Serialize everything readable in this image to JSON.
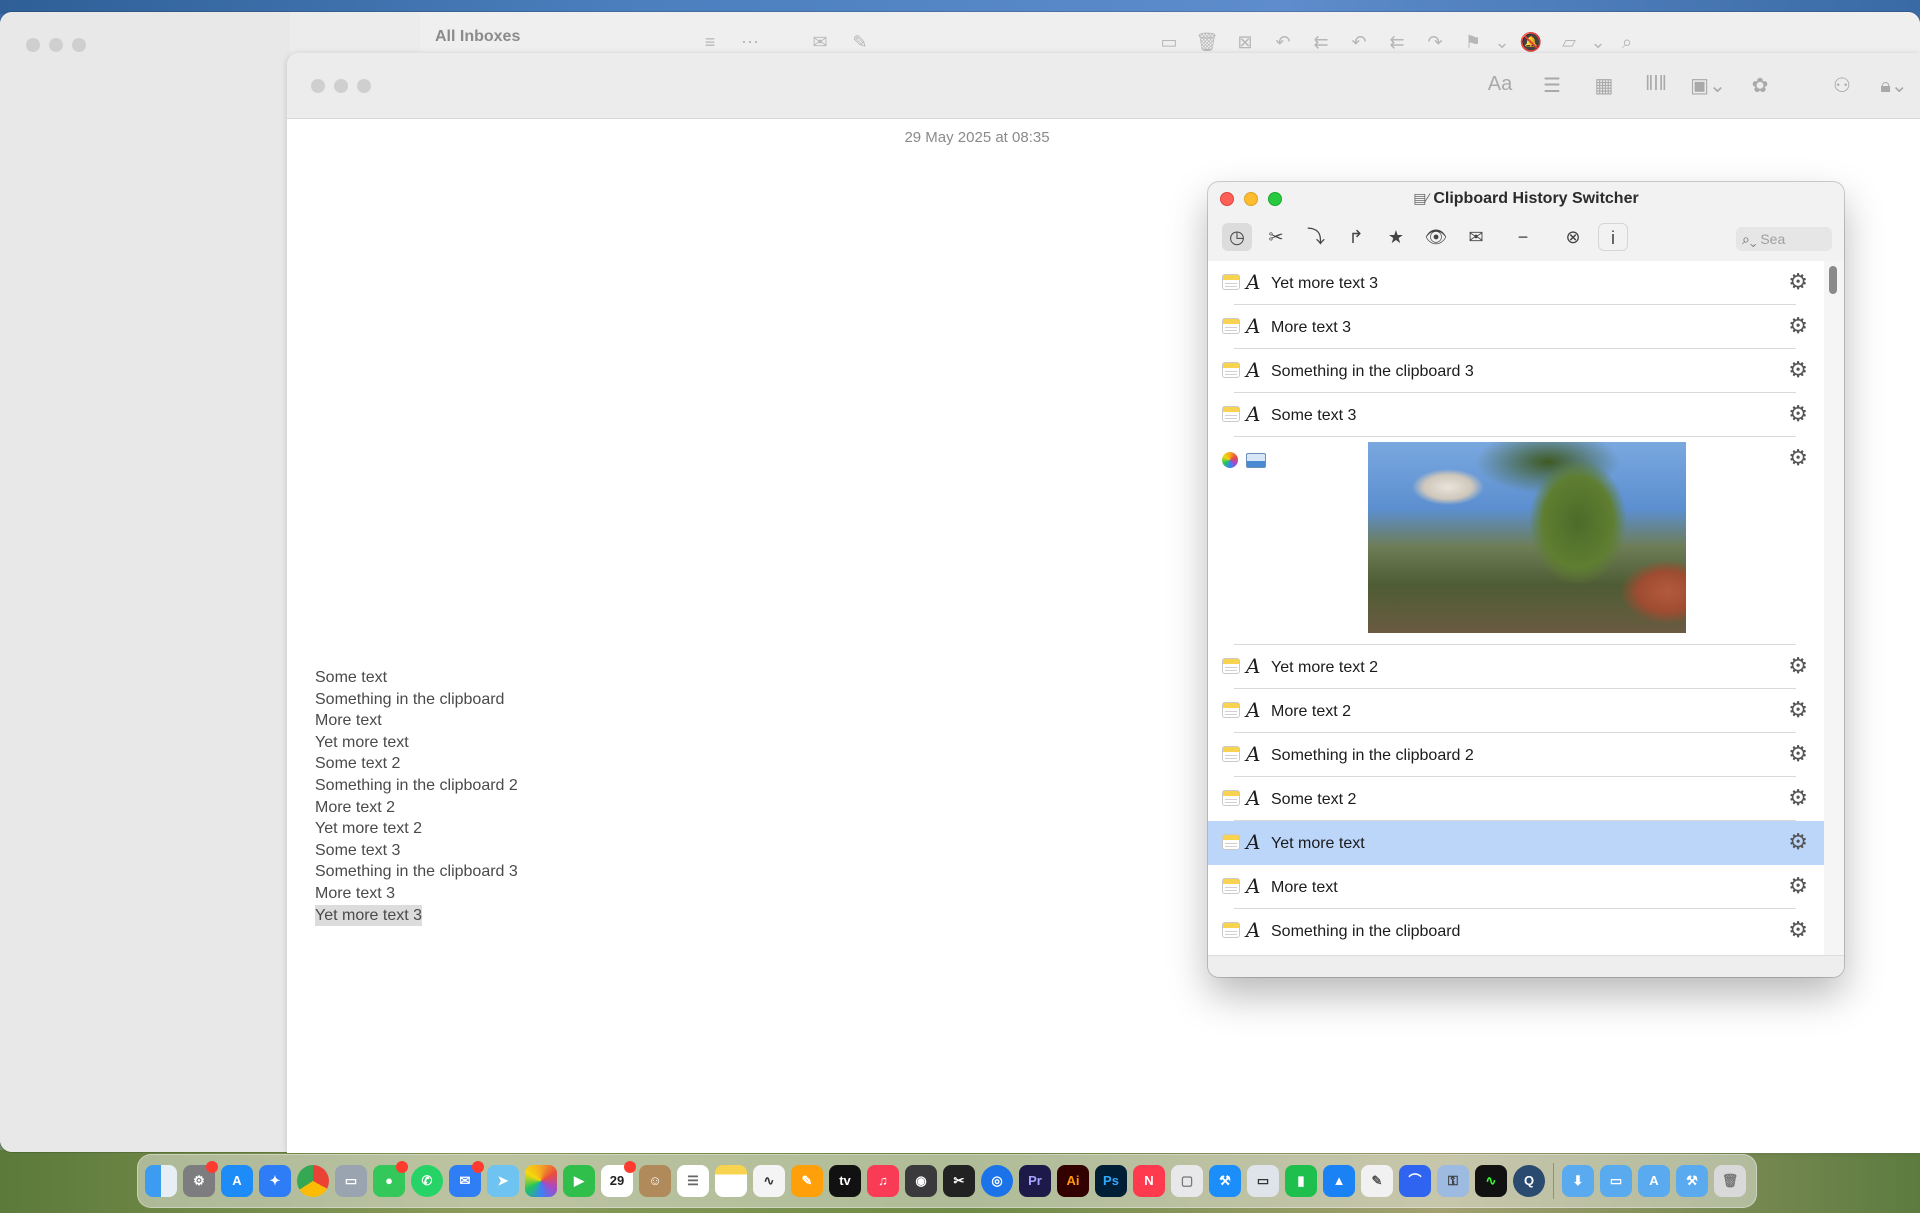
{
  "mail": {
    "title": "All Inboxes",
    "toolbar_icons": [
      "filter-icon",
      "more-icon",
      "envelope-icon",
      "compose-icon"
    ],
    "toolbar_icons_right": [
      "archive-icon",
      "trash-icon",
      "junk-icon",
      "reply-icon",
      "reply-all-icon",
      "reply-icon",
      "reply-all-icon",
      "forward-icon",
      "flag-icon",
      "chevron-down-icon",
      "mute-icon",
      "folder-icon",
      "chevron-down-icon",
      "search-icon"
    ]
  },
  "notes": {
    "date": "29 May 2025 at 08:35",
    "toolbar": {
      "format_label": "Aa",
      "icons": [
        "format-icon",
        "checklist-icon",
        "table-icon",
        "audio-icon",
        "media-icon",
        "markup-icon",
        "collaborate-icon",
        "lock-icon"
      ]
    },
    "lines": [
      "Some text",
      "Something in the clipboard",
      "More text",
      "Yet more text",
      "Some text 2",
      "Something in the clipboard 2",
      "More text 2",
      "Yet more text 2",
      "Some text 3",
      "Something in the clipboard 3",
      "More text 3",
      "Yet more text 3"
    ]
  },
  "clipboard": {
    "title": "Clipboard History Switcher",
    "search_placeholder": "Sea",
    "toolbar_icons": [
      "history-icon",
      "scissors-icon",
      "paste-icon",
      "redo-icon",
      "star-icon",
      "eye-icon",
      "mail-icon",
      "minus-icon",
      "clear-icon",
      "info-icon"
    ],
    "type_glyph": "A",
    "items": [
      {
        "text": "Yet more text 3",
        "kind": "text"
      },
      {
        "text": "More text 3",
        "kind": "text"
      },
      {
        "text": "Something in the clipboard 3",
        "kind": "text"
      },
      {
        "text": "Some text 3",
        "kind": "text"
      },
      {
        "text": "",
        "kind": "image"
      },
      {
        "text": "Yet more text 2",
        "kind": "text"
      },
      {
        "text": "More text 2",
        "kind": "text"
      },
      {
        "text": "Something in the clipboard 2",
        "kind": "text"
      },
      {
        "text": "Some text 2",
        "kind": "text"
      },
      {
        "text": "Yet more text",
        "kind": "text",
        "selected": true
      },
      {
        "text": "More text",
        "kind": "text"
      },
      {
        "text": "Something in the clipboard",
        "kind": "text"
      }
    ]
  },
  "dock": {
    "calendar_day": "29",
    "apps": [
      "finder-icon",
      "system-settings-icon",
      "app-store-icon",
      "safari-icon",
      "chrome-icon",
      "preview-icon",
      "messages-icon",
      "whatsapp-icon",
      "mail-icon",
      "maps-icon",
      "photos-icon",
      "facetime-icon",
      "calendar-icon",
      "contacts-icon",
      "reminders-icon",
      "notes-icon",
      "freeform-icon",
      "pages-icon",
      "apple-tv-icon",
      "music-icon",
      "screenshot-icon",
      "final-cut-icon",
      "vpn-icon",
      "premiere-icon",
      "illustrator-icon",
      "photoshop-icon",
      "news-icon",
      "preview-doc-icon",
      "xcode-icon",
      "screen-sharing-icon",
      "numbers-icon",
      "keynote-icon",
      "script-editor-icon",
      "arc-icon",
      "keychain-icon",
      "activity-monitor-icon",
      "quicktime-icon",
      "downloads-folder-icon",
      "desktop-folder-icon",
      "applications-folder-icon",
      "utilities-folder-icon",
      "trash-icon"
    ]
  }
}
